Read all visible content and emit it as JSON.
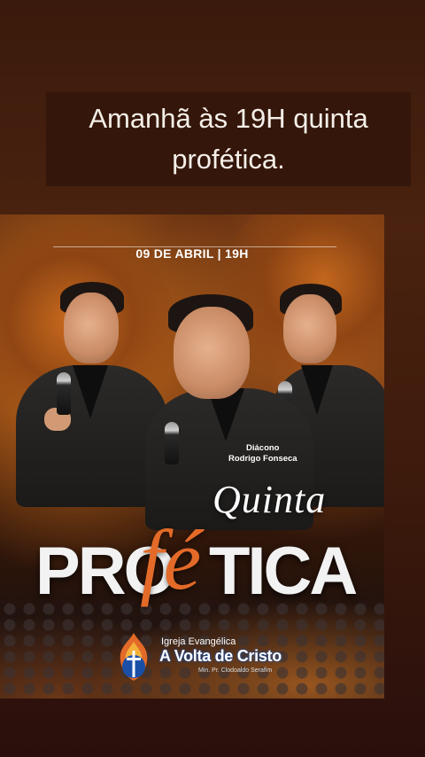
{
  "story": {
    "caption": "Amanhã às 19H quinta profética."
  },
  "poster": {
    "date_time": "09 DE ABRIL | 19H",
    "speaker_title": "Diácono",
    "speaker_name": "Rodrigo Fonseca",
    "title_top": "Quinta",
    "title_pro": "PRO",
    "title_fe": "fé",
    "title_tica": "TICA",
    "church_line1": "Igreja Evangélica",
    "church_line2": "A Volta de Cristo",
    "church_line3": "Min. Pr. Clodoaldo Serafim"
  },
  "colors": {
    "accent_orange": "#e36a28",
    "logo_blue": "#1a4fa8",
    "background_brown": "#3a1a0c"
  }
}
